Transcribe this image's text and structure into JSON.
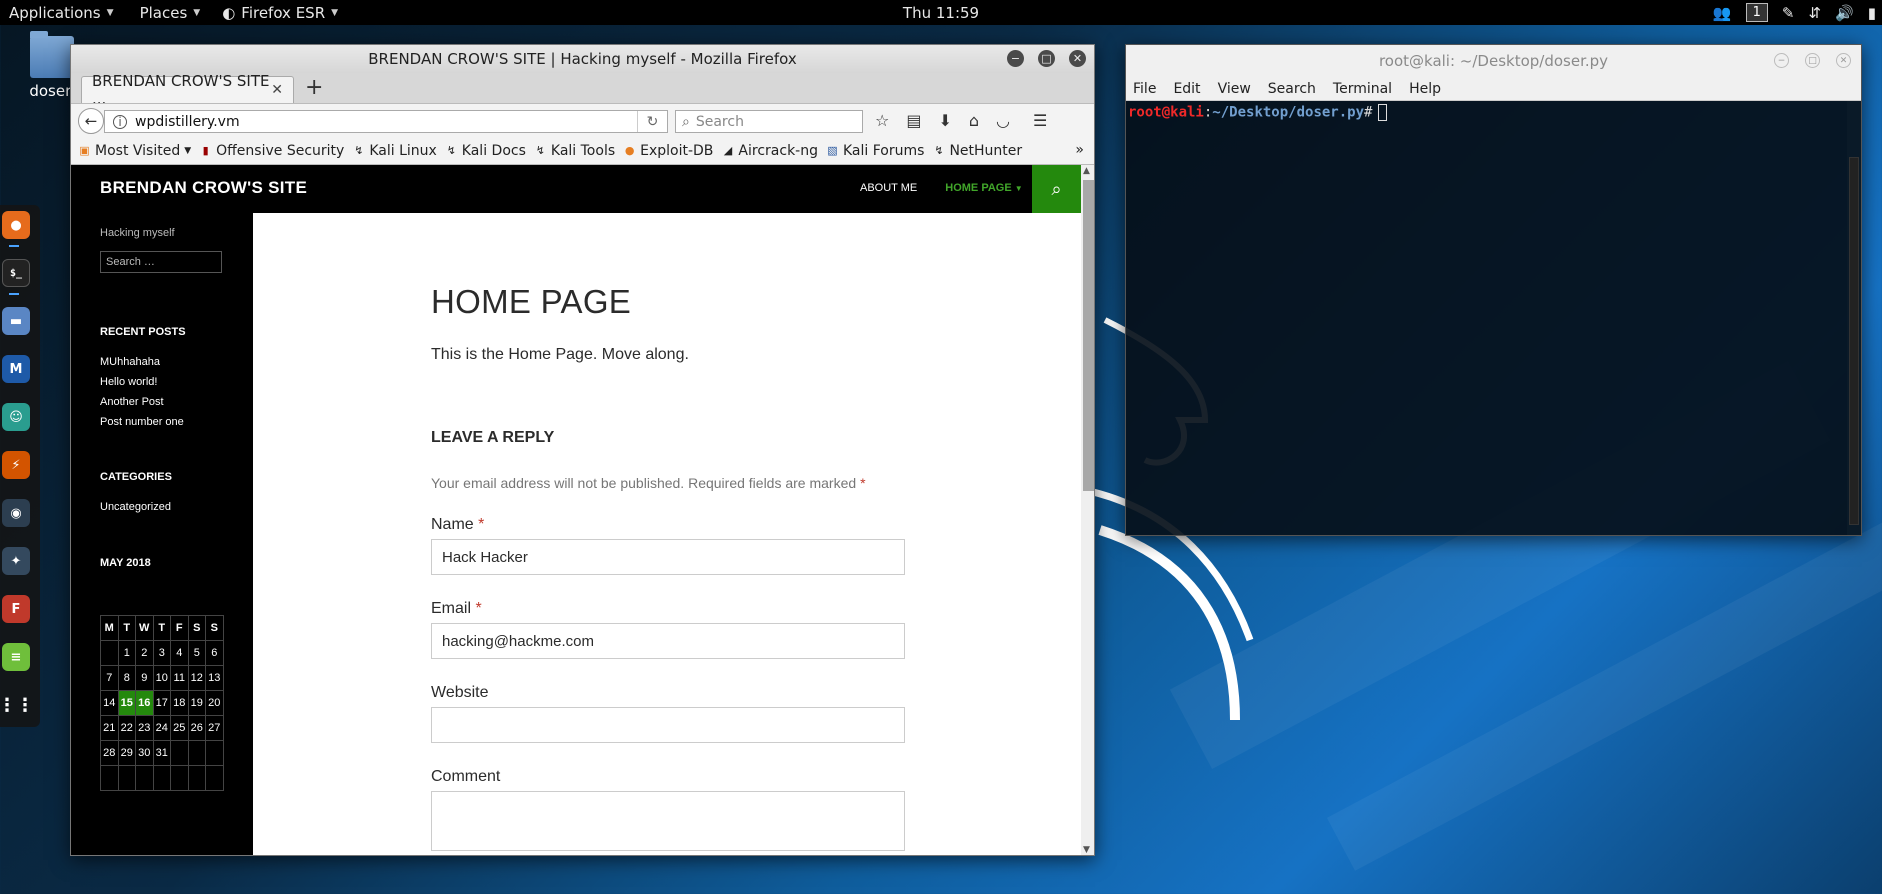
{
  "top_panel": {
    "applications": "Applications",
    "places": "Places",
    "firefox": "Firefox ESR",
    "clock": "Thu 11:59",
    "workspace": "1"
  },
  "desktop": {
    "file_label": "doser."
  },
  "firefox": {
    "window_title": "BRENDAN CROW'S SITE | Hacking myself - Mozilla Firefox",
    "tab_title": "BRENDAN CROW'S SITE ...",
    "url": "wpdistillery.vm",
    "search_placeholder": "Search",
    "bookmarks": [
      {
        "label": "Most Visited",
        "icon": "rss-icon"
      },
      {
        "label": "Offensive Security",
        "icon": "offsec-icon"
      },
      {
        "label": "Kali Linux",
        "icon": "kali-icon"
      },
      {
        "label": "Kali Docs",
        "icon": "kali-icon"
      },
      {
        "label": "Kali Tools",
        "icon": "kali-icon"
      },
      {
        "label": "Exploit-DB",
        "icon": "exploitdb-icon"
      },
      {
        "label": "Aircrack-ng",
        "icon": "aircrack-icon"
      },
      {
        "label": "Kali Forums",
        "icon": "forum-icon"
      },
      {
        "label": "NetHunter",
        "icon": "kali-icon"
      }
    ]
  },
  "site": {
    "title": "BRENDAN CROW'S SITE",
    "tagline": "Hacking myself",
    "nav_about": "ABOUT ME",
    "nav_home": "HOME PAGE",
    "sidebar_search_placeholder": "Search …",
    "recent_posts_heading": "RECENT POSTS",
    "recent_posts": [
      "MUhhahaha",
      "Hello world!",
      "Another Post",
      "Post number one"
    ],
    "categories_heading": "CATEGORIES",
    "categories": [
      "Uncategorized"
    ],
    "calendar_heading": "MAY 2018",
    "calendar_days": [
      "M",
      "T",
      "W",
      "T",
      "F",
      "S",
      "S"
    ],
    "calendar_weeks": [
      [
        "",
        "1",
        "2",
        "3",
        "4",
        "5",
        "6"
      ],
      [
        "7",
        "8",
        "9",
        "10",
        "11",
        "12",
        "13"
      ],
      [
        "14",
        "15",
        "16",
        "17",
        "18",
        "19",
        "20"
      ],
      [
        "21",
        "22",
        "23",
        "24",
        "25",
        "26",
        "27"
      ],
      [
        "28",
        "29",
        "30",
        "31",
        "",
        "",
        ""
      ],
      [
        "",
        "",
        "",
        "",
        "",
        "",
        ""
      ]
    ],
    "calendar_linked_days": [
      "15",
      "16"
    ],
    "page_title": "HOME PAGE",
    "page_body": "This is the Home Page. Move along.",
    "reply_title": "LEAVE A REPLY",
    "notes": "Your email address will not be published. Required fields are marked",
    "required_mark": "*",
    "name_label": "Name",
    "name_value": "Hack Hacker",
    "email_label": "Email",
    "email_value": "hacking@hackme.com",
    "website_label": "Website",
    "website_value": "",
    "comment_label": "Comment",
    "accent_color": "#24890d"
  },
  "terminal": {
    "title": "root@kali: ~/Desktop/doser.py",
    "menu": [
      "File",
      "Edit",
      "View",
      "Search",
      "Terminal",
      "Help"
    ],
    "prompt_user": "root@kali",
    "prompt_sep": ":",
    "prompt_path": "~/Desktop/doser.py",
    "prompt_hash": "#"
  }
}
